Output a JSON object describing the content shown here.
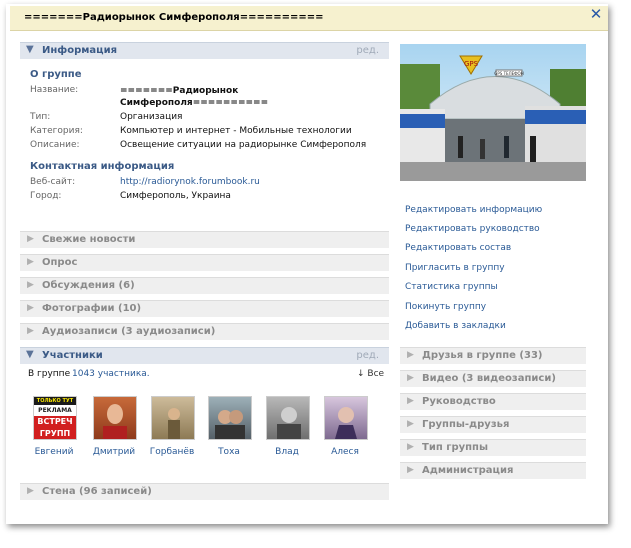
{
  "window": {
    "title": "=======Радиорынок Симферополя=========="
  },
  "info": {
    "header": "Информация",
    "edit": "ред.",
    "about_title": "О группе",
    "fields": [
      {
        "key": "Название:",
        "value": "=======Радиорынок Симферополя=========="
      },
      {
        "key": "Тип:",
        "value": "Организация"
      },
      {
        "key": "Категория:",
        "value": "Компьютер и интернет - Мобильные технологии"
      },
      {
        "key": "Описание:",
        "value": "Освещение ситуации на радиорынке Симферополя"
      }
    ],
    "contact_title": "Контактная информация",
    "website_key": "Веб-сайт:",
    "website_value": "http://radiorynok.forumbook.ru",
    "city_key": "Город:",
    "city_value": "Симферополь, Украина"
  },
  "sections": [
    {
      "label": "Свежие новости"
    },
    {
      "label": "Опрос"
    },
    {
      "label": "Обсуждения (6)"
    },
    {
      "label": "Фотографии (10)"
    },
    {
      "label": "Аудиозаписи (3 аудиозаписи)"
    }
  ],
  "members": {
    "header": "Участники",
    "edit": "ред.",
    "count_prefix": "В группе",
    "count_link": "1043 участника.",
    "all": "↓ Все",
    "avatar1_lines": [
      "ТОЛЬКО ТУТ",
      "РЕКЛАМА",
      "ВСТРЕЧ",
      "ГРУПП"
    ],
    "people": [
      {
        "name": "Евгений"
      },
      {
        "name": "Дмитрий"
      },
      {
        "name": "Горбанёв"
      },
      {
        "name": "Тоха"
      },
      {
        "name": "Влад"
      },
      {
        "name": "Алеся"
      }
    ]
  },
  "wall": {
    "label": "Стена (96 записей)"
  },
  "photo_signs": {
    "sign_gps": "GPS",
    "sign_text": "GPS ТЕЛЕФОН"
  },
  "actions": [
    {
      "label": "Редактировать информацию"
    },
    {
      "label": "Редактировать руководство"
    },
    {
      "label": "Редактировать состав"
    },
    {
      "label": "Пригласить в группу"
    },
    {
      "label": "Статистика группы"
    },
    {
      "label": "Покинуть группу"
    },
    {
      "label": "Добавить в закладки"
    }
  ],
  "right_sections": [
    {
      "label": "Друзья в группе (33)"
    },
    {
      "label": "Видео (3 видеозаписи)"
    },
    {
      "label": "Руководство"
    },
    {
      "label": "Группы-друзья"
    },
    {
      "label": "Тип группы"
    },
    {
      "label": "Администрация"
    }
  ],
  "colors": {
    "accent": "#3b5a86",
    "link": "#2a5a96",
    "title_bg": "#f6f1cf"
  }
}
